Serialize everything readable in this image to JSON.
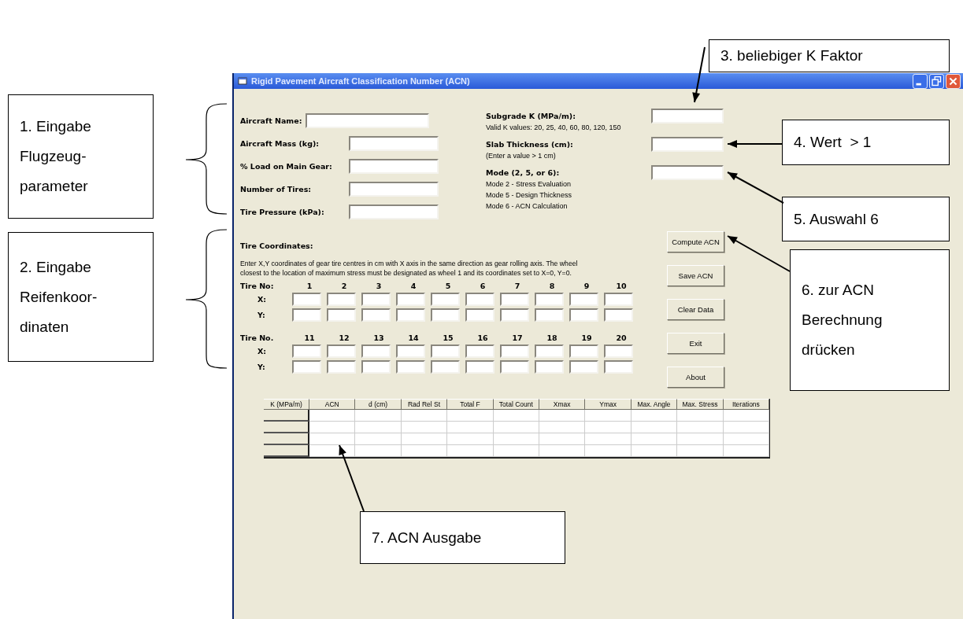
{
  "window": {
    "title": "Rigid Pavement Aircraft Classification Number (ACN)"
  },
  "aircraft_fields": [
    {
      "label": "Aircraft Name:",
      "kind": "long"
    },
    {
      "label": "Aircraft Mass (kg):",
      "kind": "short"
    },
    {
      "label": "% Load on Main Gear:",
      "kind": "short"
    },
    {
      "label": "Number of Tires:",
      "kind": "short"
    },
    {
      "label": "Tire Pressure (kPa):",
      "kind": "short"
    }
  ],
  "settings": [
    {
      "label": "Subgrade K (MPa/m):",
      "hints": [
        "Valid K values: 20, 25, 40, 60, 80, 120, 150"
      ]
    },
    {
      "label": "Slab Thickness (cm):",
      "hints": [
        "(Enter a value > 1 cm)"
      ]
    },
    {
      "label": "Mode (2, 5, or 6):",
      "hints": [
        "Mode 2 - Stress Evaluation",
        "Mode 5 - Design Thickness",
        "Mode 6 - ACN Calculation"
      ]
    }
  ],
  "tire_coordinates": {
    "title": "Tire Coordinates:",
    "instructions": "Enter X,Y coordinates of gear tire centres in cm with  X axis in the same direction as gear rolling axis.  The wheel\nclosest to the location of maximum stress must be designated as wheel 1 and its coordinates set to X=0, Y=0.",
    "groups": [
      {
        "header": "Tire No:",
        "numbers": [
          "1",
          "2",
          "3",
          "4",
          "5",
          "6",
          "7",
          "8",
          "9",
          "10"
        ],
        "rows": [
          "X:",
          "Y:"
        ]
      },
      {
        "header": "Tire No.",
        "numbers": [
          "11",
          "12",
          "13",
          "14",
          "15",
          "16",
          "17",
          "18",
          "19",
          "20"
        ],
        "rows": [
          "X:",
          "Y:"
        ]
      }
    ]
  },
  "buttons": [
    "Compute ACN",
    "Save ACN",
    "Clear Data",
    "Exit",
    "About"
  ],
  "results_table": {
    "columns": [
      "K (MPa/m)",
      "ACN",
      "d (cm)",
      "Rad Rel St",
      "Total F",
      "Total Count",
      "Xmax",
      "Ymax",
      "Max. Angle",
      "Max. Stress",
      "Iterations"
    ]
  },
  "annotations": [
    {
      "text": "1. Eingabe\nFlugzeug-\nparameter"
    },
    {
      "text": "2. Eingabe\nReifenkoor-\ndinaten"
    },
    {
      "text": "3. beliebiger K Faktor"
    },
    {
      "text": "4. Wert  > 1"
    },
    {
      "text": "5. Auswahl 6"
    },
    {
      "text": "6. zur ACN\nBerechnung\ndrücken"
    },
    {
      "text": "7. ACN Ausgabe"
    }
  ]
}
